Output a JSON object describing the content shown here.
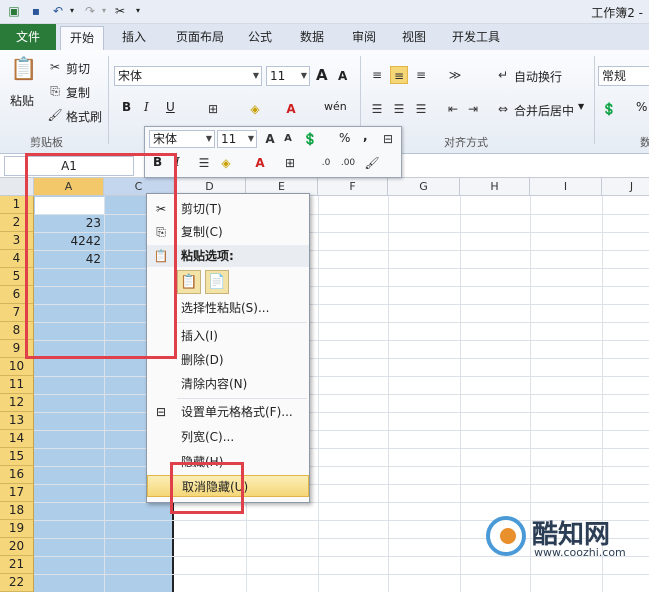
{
  "window": {
    "title": "工作簿2 -"
  },
  "tabs": [
    {
      "label": "文件"
    },
    {
      "label": "开始"
    },
    {
      "label": "插入"
    },
    {
      "label": "页面布局"
    },
    {
      "label": "公式"
    },
    {
      "label": "数据"
    },
    {
      "label": "审阅"
    },
    {
      "label": "视图"
    },
    {
      "label": "开发工具"
    }
  ],
  "ribbon": {
    "clipboard": {
      "paste_label": "粘贴",
      "cut_label": "剪切",
      "copy_label": "复制",
      "format_painter_label": "格式刷",
      "group_label": "剪贴板"
    },
    "font": {
      "font_name": "宋体",
      "font_size": "11",
      "bold": "B",
      "italic": "I",
      "underline": "U",
      "grow_font": "A",
      "shrink_font": "A",
      "phonetic_label": "wén"
    },
    "alignment": {
      "wrap_text_label": "自动换行",
      "merge_center_label": "合并后居中",
      "group_label": "对齐方式"
    },
    "number": {
      "format": "常规",
      "percent": "%",
      "group_label_partial": "数"
    }
  },
  "formula_bar": {
    "name_box": "A1"
  },
  "grid": {
    "columns": [
      "A",
      "C",
      "D",
      "E",
      "F",
      "G",
      "H",
      "I",
      "J"
    ],
    "rows": [
      "1",
      "2",
      "3",
      "4",
      "5",
      "6",
      "7",
      "8",
      "9",
      "10",
      "11",
      "12",
      "13",
      "14",
      "15",
      "16",
      "17",
      "18",
      "19",
      "20",
      "21",
      "22"
    ],
    "cells": [
      {
        "ref": "A2",
        "value": "23"
      },
      {
        "ref": "A3",
        "value": "4242"
      },
      {
        "ref": "A4",
        "value": "42"
      }
    ]
  },
  "mini_toolbar": {
    "font_name": "宋体",
    "font_size": "11",
    "bold": "B",
    "italic": "I",
    "percent": "%",
    "comma": ","
  },
  "context_menu": {
    "items": [
      {
        "label": "剪切(T)",
        "icon": "scissors-icon"
      },
      {
        "label": "复制(C)",
        "icon": "copy-icon"
      },
      {
        "label": "粘贴选项:",
        "icon": "paste-icon"
      },
      {
        "label": "选择性粘贴(S)..."
      },
      {
        "label": "插入(I)"
      },
      {
        "label": "删除(D)"
      },
      {
        "label": "清除内容(N)"
      },
      {
        "label": "设置单元格格式(F)...",
        "icon": "format-cells-icon"
      },
      {
        "label": "列宽(C)..."
      },
      {
        "label": "隐藏(H)"
      },
      {
        "label": "取消隐藏(U)"
      }
    ]
  },
  "watermark": {
    "brand": "酷知网",
    "url": "www.coozhi.com"
  },
  "colors": {
    "file_tab": "#2a7a3a",
    "selection": "#aecde8",
    "row_header": "#f6d67a",
    "annotation": "#e0404a",
    "menu_highlight": "#f5d778"
  }
}
